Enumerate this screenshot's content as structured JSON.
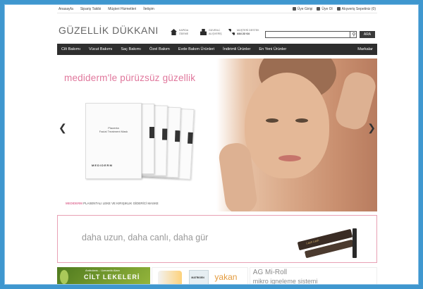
{
  "topbar": {
    "links": [
      "Anasayfa",
      "Sipariş Takibi",
      "Müşteri Hizmetleri",
      "İletişim"
    ],
    "login": "Üye Girişi",
    "register": "Üye Ol",
    "cart": "Alışveriş Sepetiniz (0)"
  },
  "header": {
    "logo": "GÜZELLİK DÜKKANI",
    "feature1": [
      "KAPIDA",
      "ÖDEME"
    ],
    "feature2": [
      "GÜVENLİ",
      "ALIŞVERİŞ"
    ],
    "feature3_label": "MÜŞTERİ DESTEK",
    "feature3_number": "444 22 64",
    "search_button": "ARA"
  },
  "nav": {
    "items": [
      "Cilt Bakımı",
      "Vücut Bakımı",
      "Saç Bakımı",
      "Özel Bakım",
      "Evde Bakım Ürünleri",
      "İndirimli Ürünler",
      "En Yeni Ürünler"
    ],
    "right": "Markalar"
  },
  "hero": {
    "title": "mediderm'le pürüzsüz güzellik",
    "sheet_title": "Placenta\nFacial Treatment Mask",
    "sheet_brand": "MEDIDERM",
    "caption_brand": "MEDIDERM",
    "caption_text": "PLASENTALI LEKE VE KIRIŞIKLIK GİDERİCİ MASKE"
  },
  "banner2": {
    "text": "daha uzun, daha canlı, daha gür",
    "product": "Lash Lash"
  },
  "promos": {
    "tile1_small": "Ambulans... Uzmanlık Alanı",
    "tile1_big": "CİLT LEKELERİ",
    "tile2_box": "MATRIGEN",
    "tile2_text": "yakan",
    "tile3_line1": "AG Mi-Roll",
    "tile3_line2": "mikro igneleme sistemi"
  },
  "colors": {
    "background": "#3f97cf",
    "nav": "#2e2e2e",
    "accent_pink": "#e0779c"
  },
  "icons": [
    "house-icon",
    "lock-icon",
    "phone-icon",
    "user-icon",
    "cart-icon",
    "search-icon",
    "arrow-left-icon",
    "arrow-right-icon"
  ]
}
